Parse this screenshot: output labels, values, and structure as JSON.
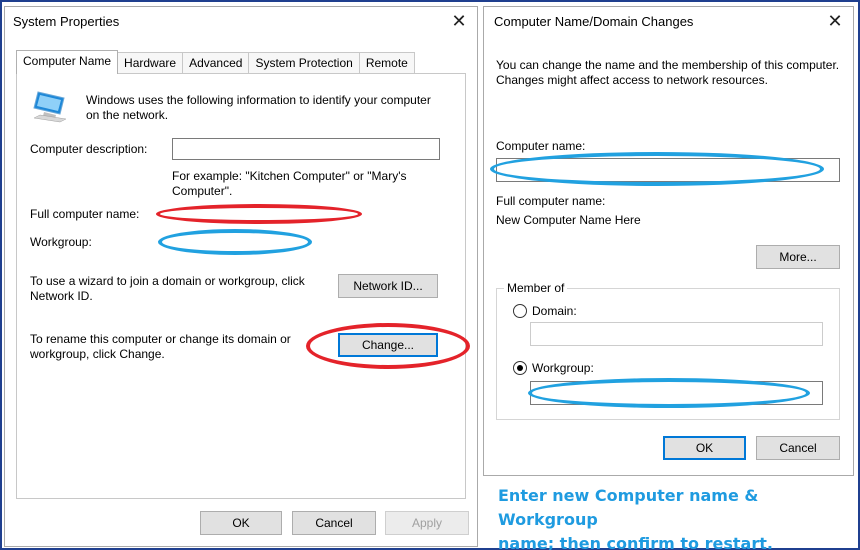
{
  "sys_props": {
    "title": "System Properties",
    "close": "✕",
    "tabs": [
      {
        "label": "Computer Name"
      },
      {
        "label": "Hardware"
      },
      {
        "label": "Advanced"
      },
      {
        "label": "System Protection"
      },
      {
        "label": "Remote"
      }
    ],
    "intro": "Windows uses the following information to identify your computer on the network.",
    "description_label": "Computer description:",
    "description_value": "",
    "example_text": "For example: \"Kitchen Computer\" or \"Mary's Computer\".",
    "full_name_label": "Full computer name:",
    "full_name_value": "",
    "workgroup_label": "Workgroup:",
    "workgroup_value": "",
    "wizard_text": "To use a wizard to join a domain or workgroup, click Network ID.",
    "network_id_button": "Network ID...",
    "rename_text": "To rename this computer or change its domain or workgroup, click Change.",
    "change_button": "Change...",
    "ok_button": "OK",
    "cancel_button": "Cancel",
    "apply_button": "Apply"
  },
  "domain_changes": {
    "title": "Computer Name/Domain Changes",
    "close": "✕",
    "intro": "You can change the name and the membership of this computer. Changes might affect access to network resources.",
    "computer_name_label": "Computer name:",
    "computer_name_value": "",
    "full_name_label": "Full computer name:",
    "full_name_value": "New Computer Name Here",
    "more_button": "More...",
    "member_of_label": "Member of",
    "domain_label": "Domain:",
    "domain_value": "",
    "workgroup_label": "Workgroup:",
    "workgroup_value": "",
    "selected_membership": "Workgroup",
    "ok_button": "OK",
    "cancel_button": "Cancel"
  },
  "caption": {
    "line1": "Enter new Computer name & Workgroup",
    "line2": "name; then confirm to restart."
  },
  "colors": {
    "highlight_red": "#e4232a",
    "highlight_blue": "#21a1e0",
    "caption": "#1f9be0",
    "frame": "#1f3f8f"
  }
}
